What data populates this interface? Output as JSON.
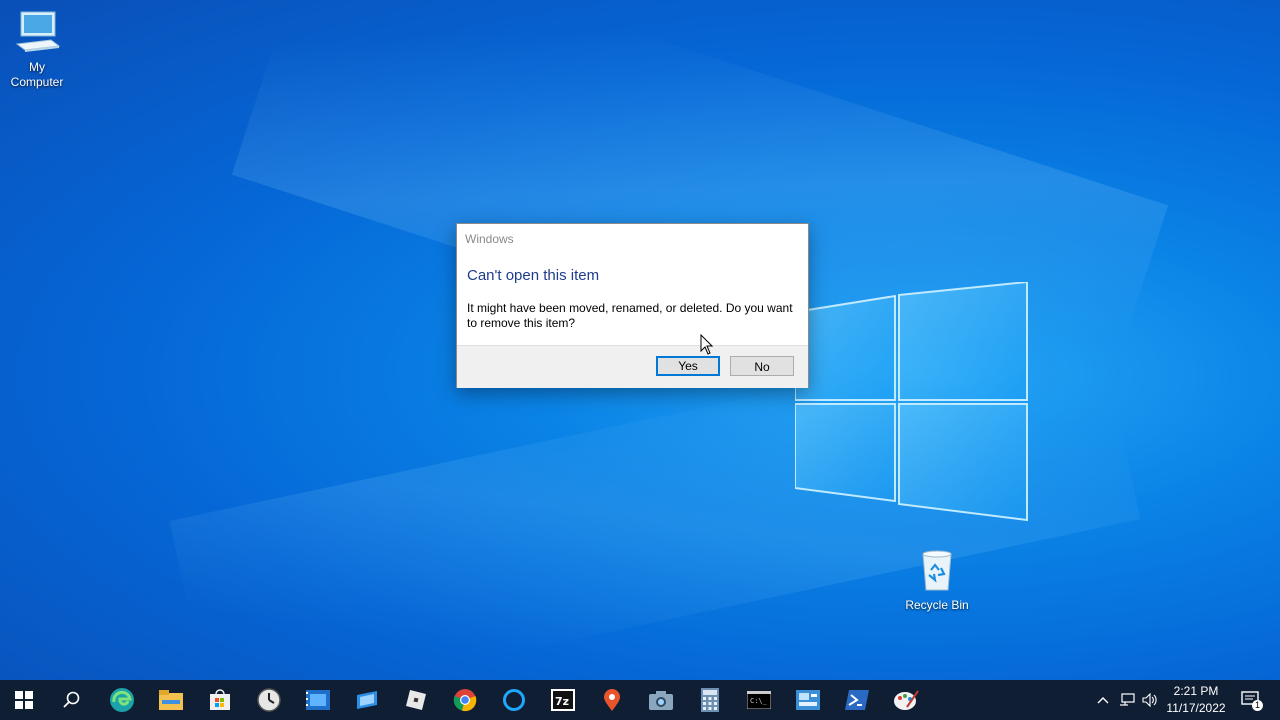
{
  "desktop": {
    "icons": [
      {
        "label": "My\nComputer",
        "icon": "my-computer-icon"
      },
      {
        "label": "Recycle Bin",
        "icon": "recycle-bin-icon"
      }
    ]
  },
  "dialog": {
    "title": "Windows",
    "heading": "Can't open this item",
    "message": "It might have been moved, renamed, or deleted. Do you want to remove this item?",
    "yes_label": "Yes",
    "no_label": "No"
  },
  "taskbar": {
    "apps": [
      "start-icon",
      "search-icon",
      "edge-icon",
      "file-explorer-icon",
      "store-icon",
      "clock-app-icon",
      "video-editor-icon",
      "deploy-icon",
      "roblox-icon",
      "chrome-icon",
      "cortana-icon",
      "7zip-icon",
      "maps-pin-icon",
      "camera-icon",
      "calculator-icon",
      "terminal-icon",
      "control-panel-icon",
      "powershell-icon",
      "paint-icon"
    ],
    "time": "2:21 PM",
    "date": "11/17/2022",
    "notification_count": "1"
  },
  "colors": {
    "accent": "#0078d7",
    "heading": "#1e3c8c",
    "taskbar": "#101e33"
  }
}
